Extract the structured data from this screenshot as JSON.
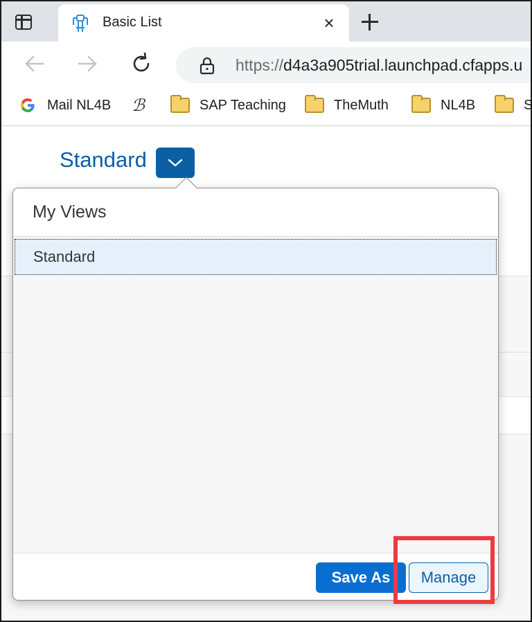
{
  "browser": {
    "tab": {
      "title": "Basic List",
      "close_glyph": "×"
    },
    "address": {
      "scheme": "https://",
      "host": "d4a3a905trial.launchpad.cfapps.u"
    },
    "bookmarks": [
      {
        "label": "Mail NL4B",
        "icon": "google-icon"
      },
      {
        "label": "",
        "icon": "signature-icon"
      },
      {
        "label": "SAP Teaching",
        "icon": "folder-icon"
      },
      {
        "label": "TheMuth",
        "icon": "folder-icon"
      },
      {
        "label": "NL4B",
        "icon": "folder-icon"
      },
      {
        "label": "S",
        "icon": "folder-icon"
      }
    ]
  },
  "page": {
    "variant_title": "Standard"
  },
  "popover": {
    "title": "My Views",
    "views": [
      {
        "label": "Standard",
        "selected": true
      }
    ],
    "buttons": {
      "save_as": "Save As",
      "manage": "Manage"
    }
  },
  "colors": {
    "accent": "#0a5fa6",
    "emphasized_button": "#0a6ed1",
    "highlight": "#ee3b42",
    "selected_row": "#e5f0fa"
  }
}
